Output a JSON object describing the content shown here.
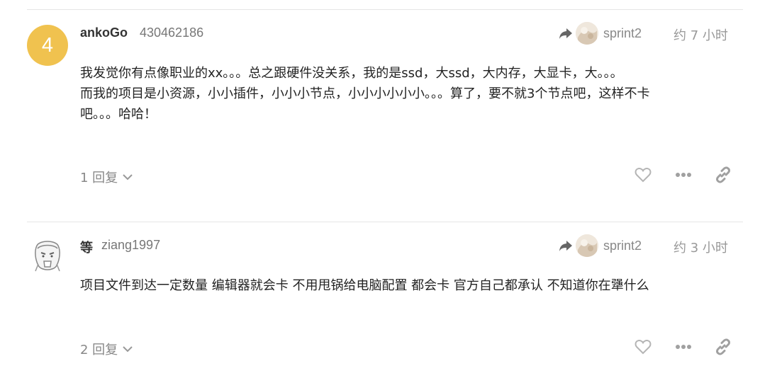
{
  "posts": [
    {
      "avatar_letter": "4",
      "avatar_color": "#f0c24f",
      "username": "ankoGo",
      "fullname": "430462186",
      "reply_to": "sprint2",
      "timestamp": "约 7 小时",
      "body_lines": [
        "我发觉你有点像职业的xx。。。总之跟硬件没关系，我的是ssd，大ssd，大内存，大显卡，大。。。",
        "而我的项目是小资源，小小插件，小小小节点，小小小小小小。。。算了，要不就3个节点吧，这样不卡",
        "吧。。。哈哈！"
      ],
      "replies_label": "1 回复",
      "icons": [
        "heart-icon",
        "more-icon",
        "link-icon"
      ]
    },
    {
      "avatar_letter": "",
      "username": "等",
      "fullname": "ziang1997",
      "reply_to": "sprint2",
      "timestamp": "约 3 小时",
      "body_lines": [
        "项目文件到达一定数量 编辑器就会卡 不用甩锅给电脑配置 都会卡 官方自己都承认 不知道你在犟什么"
      ],
      "replies_label": "2 回复",
      "icons": [
        "heart-icon",
        "more-icon",
        "link-icon"
      ]
    }
  ]
}
